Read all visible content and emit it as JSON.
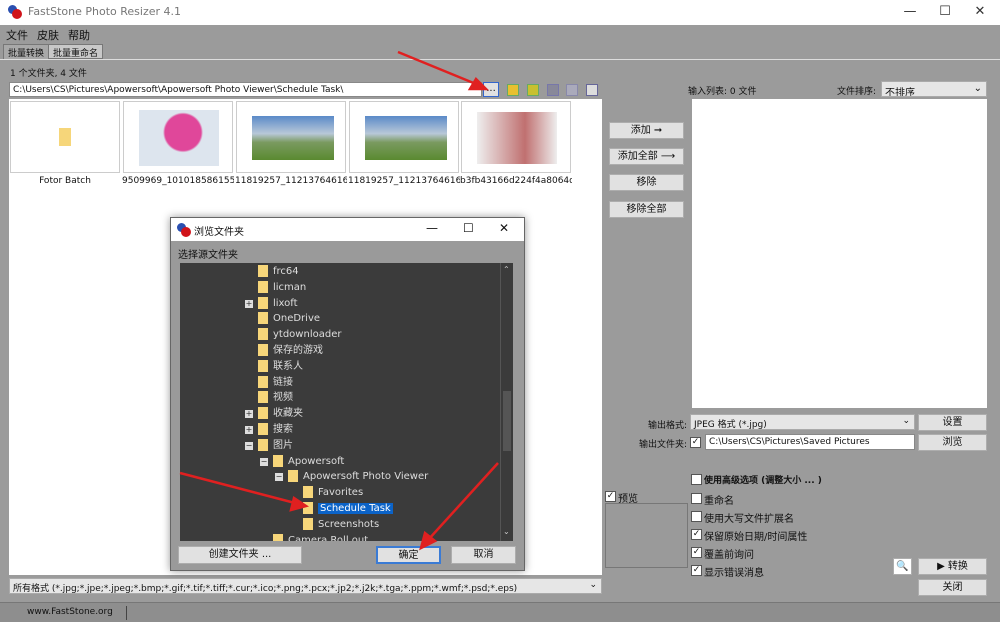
{
  "window": {
    "title": "FastStone Photo Resizer 4.1",
    "minimize": "—",
    "maximize": "☐",
    "close": "✕"
  },
  "menu": [
    "文件",
    "皮肤",
    "帮助"
  ],
  "tabs": [
    "批量转换",
    "批量重命名"
  ],
  "browser": {
    "count_text": "1 个文件夹, 4 文件",
    "path": "C:\\Users\\CS\\Pictures\\Apowersoft\\Apowersoft Photo Viewer\\Schedule Task\\",
    "browse_btn": "...",
    "items": [
      "Fotor Batch",
      "9509969_101018586155_...",
      "11819257_112137646160...",
      "11819257_112137646160...",
      "b3fb43166d224f4a8064d..."
    ],
    "filter": "所有格式 (*.jpg;*.jpe;*.jpeg;*.bmp;*.gif;*.tif;*.tiff;*.cur;*.ico;*.png;*.pcx;*.jp2;*.j2k;*.tga;*.ppm;*.wmf;*.psd;*.eps)"
  },
  "actions": {
    "add": "添加 ➞",
    "add_all": "添加全部 ⟶",
    "remove": "移除",
    "remove_all": "移除全部"
  },
  "input_list": {
    "label": "输入列表: 0 文件",
    "sort_label": "文件排序:",
    "sort_value": "不排序"
  },
  "output": {
    "format_label": "输出格式:",
    "format_value": "JPEG 格式 (*.jpg)",
    "settings": "设置",
    "folder_label": "输出文件夹:",
    "folder_value": "C:\\Users\\CS\\Pictures\\Saved Pictures",
    "browse": "浏览"
  },
  "options": [
    {
      "label": "使用高级选项 (调整大小 ... )",
      "checked": false
    },
    {
      "label": "重命名",
      "checked": false
    },
    {
      "label": "使用大写文件扩展名",
      "checked": false
    },
    {
      "label": "保留原始日期/时间属性",
      "checked": true
    },
    {
      "label": "覆盖前询问",
      "checked": true
    },
    {
      "label": "显示错误消息",
      "checked": true
    }
  ],
  "preview": {
    "label": "预览",
    "checked": true
  },
  "convert": "▶ 转换",
  "close_btn": "关闭",
  "status": "www.FastStone.org",
  "dialog": {
    "title": "浏览文件夹",
    "subtitle": "选择源文件夹",
    "new_folder": "创建文件夹 ...",
    "ok": "确定",
    "cancel": "取消",
    "tree": [
      {
        "label": "frc64",
        "level": 0,
        "exp": ""
      },
      {
        "label": "licman",
        "level": 0,
        "exp": ""
      },
      {
        "label": "lixoft",
        "level": 0,
        "exp": "+"
      },
      {
        "label": "OneDrive",
        "level": 0,
        "exp": ""
      },
      {
        "label": "ytdownloader",
        "level": 0,
        "exp": ""
      },
      {
        "label": "保存的游戏",
        "level": 0,
        "exp": ""
      },
      {
        "label": "联系人",
        "level": 0,
        "exp": ""
      },
      {
        "label": "链接",
        "level": 0,
        "exp": ""
      },
      {
        "label": "视频",
        "level": 0,
        "exp": ""
      },
      {
        "label": "收藏夹",
        "level": 0,
        "exp": "+"
      },
      {
        "label": "搜索",
        "level": 0,
        "exp": "+"
      },
      {
        "label": "图片",
        "level": 0,
        "exp": "−"
      },
      {
        "label": "Apowersoft",
        "level": 1,
        "exp": "−"
      },
      {
        "label": "Apowersoft Photo Viewer",
        "level": 2,
        "exp": "−"
      },
      {
        "label": "Favorites",
        "level": 3,
        "exp": ""
      },
      {
        "label": "Schedule Task",
        "level": 3,
        "exp": "",
        "selected": true
      },
      {
        "label": "Screenshots",
        "level": 3,
        "exp": ""
      },
      {
        "label": "Camera Roll out",
        "level": 1,
        "exp": ""
      }
    ]
  },
  "colors": {
    "selection": "#0b63c8",
    "arrow": "#e02020",
    "tree_bg": "#3b3b3b"
  }
}
